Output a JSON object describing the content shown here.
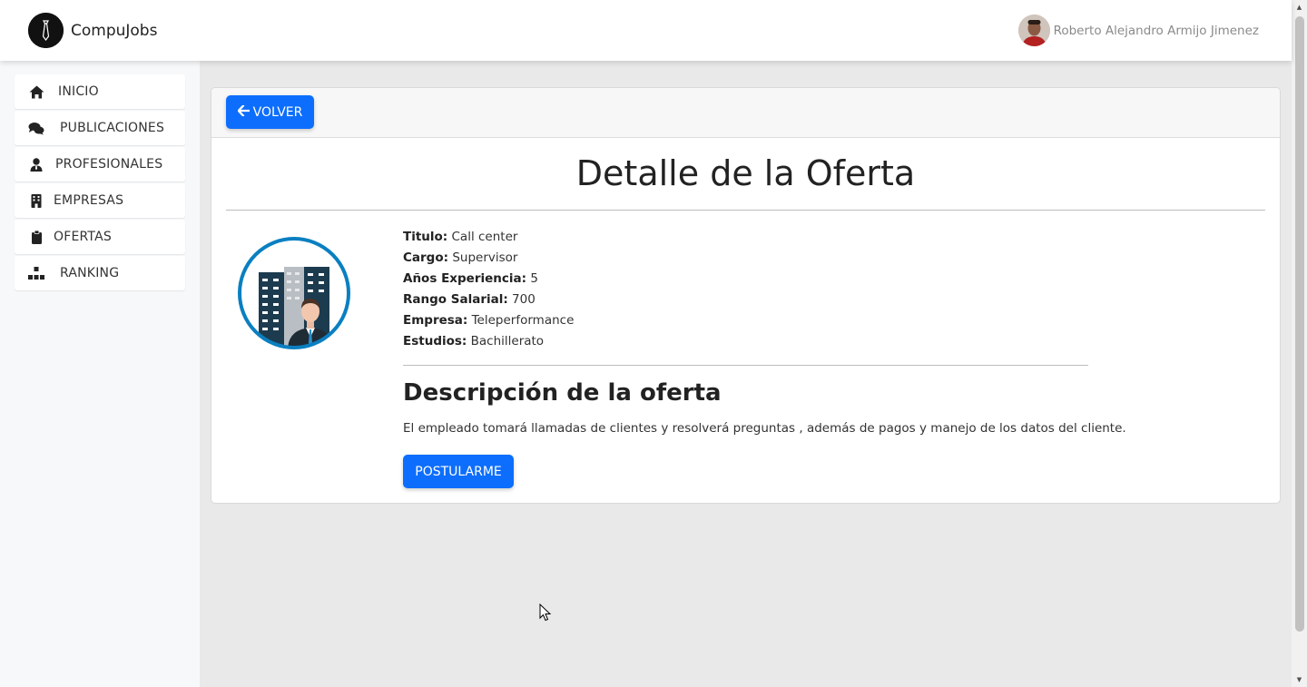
{
  "app": {
    "name": "CompuJobs",
    "user_name": "Roberto Alejandro Armijo Jimenez"
  },
  "sidebar": {
    "items": [
      {
        "label": "INICIO",
        "icon": "home-icon"
      },
      {
        "label": "PUBLICACIONES",
        "icon": "comments-icon"
      },
      {
        "label": "PROFESIONALES",
        "icon": "user-tie-icon"
      },
      {
        "label": "EMPRESAS",
        "icon": "building-icon"
      },
      {
        "label": "OFERTAS",
        "icon": "clipboard-icon"
      },
      {
        "label": "RANKING",
        "icon": "ranking-icon"
      }
    ]
  },
  "card": {
    "back_label": "VOLVER",
    "title": "Detalle de la Oferta",
    "fields": [
      {
        "label": "Titulo:",
        "value": "Call center"
      },
      {
        "label": "Cargo:",
        "value": "Supervisor"
      },
      {
        "label": "Años Experiencia:",
        "value": "5"
      },
      {
        "label": "Rango Salarial:",
        "value": "700"
      },
      {
        "label": "Empresa:",
        "value": "Teleperformance"
      },
      {
        "label": "Estudios:",
        "value": "Bachillerato"
      }
    ],
    "description_title": "Descripción de la oferta",
    "description": "El empleado tomará llamadas de clientes y resolverá preguntas , además de pagos y manejo de los datos del cliente.",
    "apply_label": "POSTULARME"
  },
  "colors": {
    "primary": "#0d6efd",
    "logo_ring": "#0a7fc1"
  }
}
